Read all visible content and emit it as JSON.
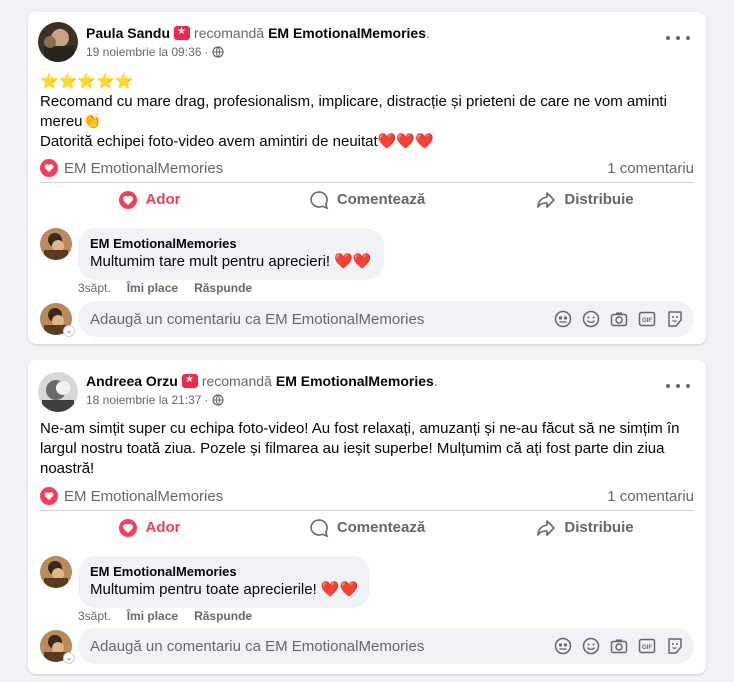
{
  "posts": [
    {
      "author": "Paula Sandu",
      "recommends": "recomandă",
      "page": "EM EmotionalMemories",
      "date": "19 noiembrie la 09:36",
      "stars": "⭐⭐⭐⭐⭐",
      "body_lines": [
        "Recomand cu mare drag, profesionalism, implicare, distracție și prieteni de care ne vom aminti",
        "mereu👏",
        "Datorită echipei foto-video avem amintiri de neuitat❤️❤️❤️"
      ],
      "reactor": "EM EmotionalMemories",
      "comment_count": "1 comentariu",
      "actions": {
        "like": "Ador",
        "comment": "Comentează",
        "share": "Distribuie"
      },
      "comment": {
        "author": "EM EmotionalMemories",
        "text": "Multumim tare mult pentru aprecieri! ❤️❤️",
        "time": "3săpt.",
        "like": "Îmi place",
        "reply": "Răspunde"
      },
      "composer_placeholder": "Adaugă un comentariu ca EM EmotionalMemories"
    },
    {
      "author": "Andreea Orzu",
      "recommends": "recomandă",
      "page": "EM EmotionalMemories",
      "date": "18 noiembrie la 21:37",
      "body_lines": [
        "Ne-am simțit super cu echipa foto-video! Au fost relaxați, amuzanți și ne-au făcut să ne simțim în",
        "largul nostru toată ziua. Pozele și filmarea au ieșit superbe! Mulțumim că ați fost parte din ziua",
        "noastră!"
      ],
      "reactor": "EM EmotionalMemories",
      "comment_count": "1 comentariu",
      "actions": {
        "like": "Ador",
        "comment": "Comentează",
        "share": "Distribuie"
      },
      "comment": {
        "author": "EM EmotionalMemories",
        "text": "Multumim pentru toate aprecierile! ❤️❤️",
        "time": "3săpt.",
        "like": "Îmi place",
        "reply": "Răspunde"
      },
      "composer_placeholder": "Adaugă un comentariu ca EM EmotionalMemories"
    }
  ],
  "icons": {
    "recommend_badge": "recommend-icon",
    "globe": "globe-icon",
    "more": "more-options-icon",
    "love": "love-react-icon",
    "comment": "comment-icon",
    "share": "share-icon",
    "composer": [
      "avatar-sticker-icon",
      "emoji-icon",
      "camera-icon",
      "gif-icon",
      "sticker-icon"
    ]
  },
  "colors": {
    "love": "#f33e58",
    "secondary_text": "#65676b",
    "background": "#f0f2f5",
    "star": "#f7b928"
  }
}
